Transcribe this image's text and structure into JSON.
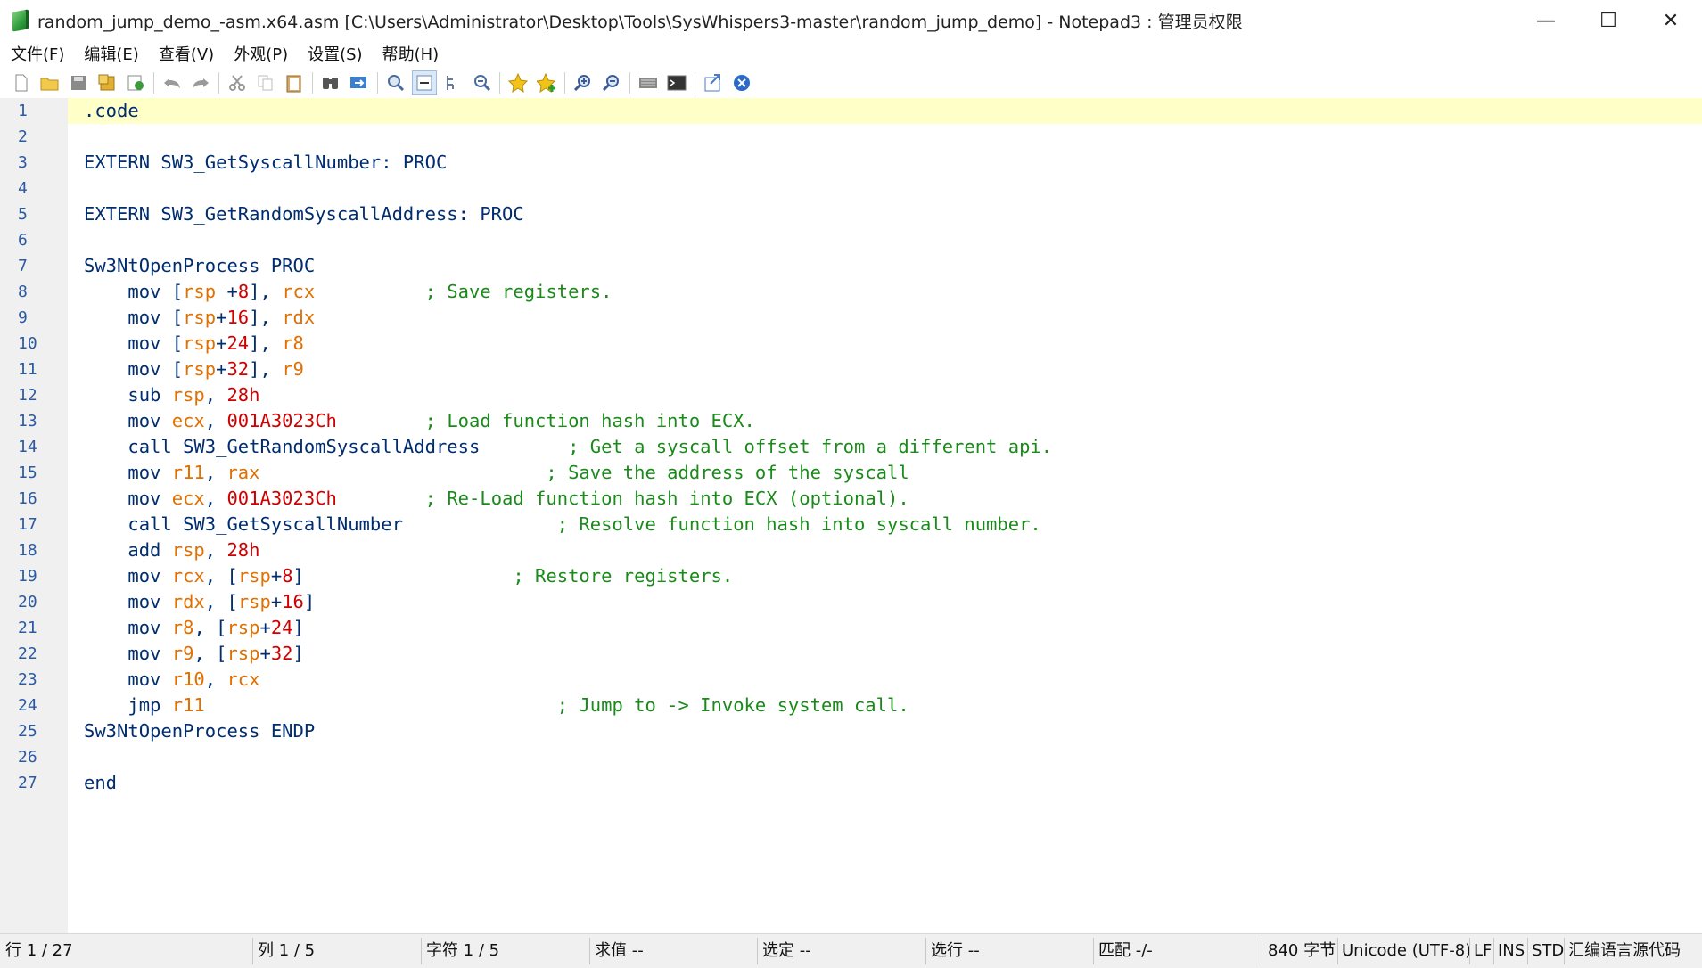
{
  "window": {
    "title": "random_jump_demo_-asm.x64.asm [C:\\Users\\Administrator\\Desktop\\Tools\\SysWhispers3-master\\random_jump_demo] - Notepad3 : 管理员权限",
    "minimize_glyph": "—",
    "maximize_glyph": "☐",
    "close_glyph": "✕"
  },
  "menu": [
    "文件(F)",
    "编辑(E)",
    "查看(V)",
    "外观(P)",
    "设置(S)",
    "帮助(H)"
  ],
  "toolbar": {
    "icons": [
      "new-file-icon",
      "open-file-icon",
      "save-icon",
      "save-as-icon",
      "copy-to-icon",
      "undo-icon",
      "redo-icon",
      "cut-icon",
      "copy-icon",
      "paste-icon",
      "find-icon",
      "replace-icon",
      "find-next-icon",
      "word-wrap-icon",
      "indent-guides-icon",
      "find-in-files-icon",
      "favorites-icon",
      "add-favorite-icon",
      "zoom-in-icon",
      "zoom-out-icon",
      "keyboard-icon",
      "terminal-icon",
      "export-icon",
      "exit-icon"
    ]
  },
  "editor": {
    "line_numbers": [
      "1",
      "2",
      "3",
      "4",
      "5",
      "6",
      "7",
      "8",
      "9",
      "10",
      "11",
      "12",
      "13",
      "14",
      "15",
      "16",
      "17",
      "18",
      "19",
      "20",
      "21",
      "22",
      "23",
      "24",
      "25",
      "26",
      "27"
    ]
  },
  "status": {
    "line": "行  1 / 27",
    "column": "列  1 / 5",
    "char": "字符  1 / 5",
    "sum": "求值  --",
    "selection": "选定  --",
    "selected_lines": "选行  --",
    "match": "匹配  -/-",
    "size": "840 字节",
    "encoding": "Unicode (UTF-8)",
    "eol": "LF",
    "ins": "INS",
    "std": "STD",
    "lexer": "汇编语言源代码"
  }
}
